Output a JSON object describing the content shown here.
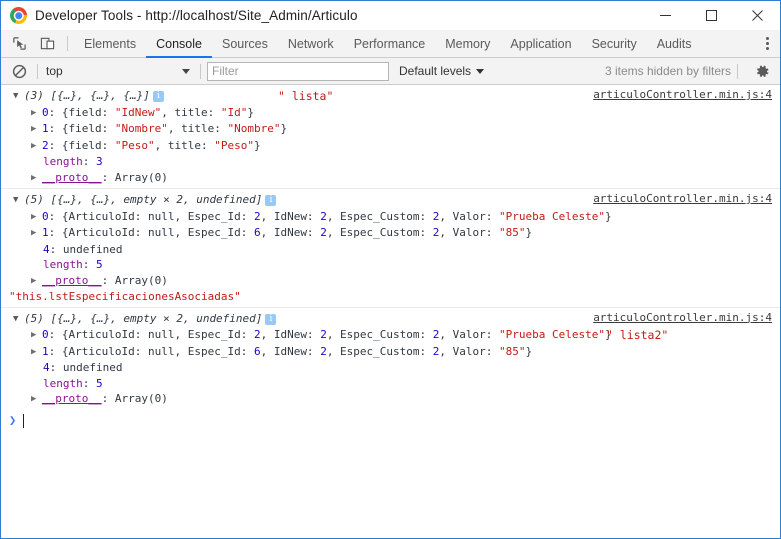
{
  "window": {
    "title": "Developer Tools - http://localhost/Site_Admin/Articulo",
    "logo_icon": "chrome-logo-icon",
    "minimize_icon": "minimize-icon",
    "maximize_icon": "maximize-icon",
    "close_icon": "close-icon"
  },
  "toolbar": {
    "inspect_icon": "inspect-element-icon",
    "device_icon": "device-toolbar-icon",
    "more_icon": "kebab-menu-icon",
    "tabs": [
      {
        "label": "Elements",
        "active": false
      },
      {
        "label": "Console",
        "active": true
      },
      {
        "label": "Sources",
        "active": false
      },
      {
        "label": "Network",
        "active": false
      },
      {
        "label": "Performance",
        "active": false
      },
      {
        "label": "Memory",
        "active": false
      },
      {
        "label": "Application",
        "active": false
      },
      {
        "label": "Security",
        "active": false
      },
      {
        "label": "Audits",
        "active": false
      }
    ],
    "active_tab_accent": "#1a73e8"
  },
  "filterbar": {
    "clear_icon": "clear-console-icon",
    "context_value": "top",
    "context_caret_icon": "chevron-down-icon",
    "filter_placeholder": "Filter",
    "filter_value": "",
    "levels_label": "Default levels",
    "levels_caret_icon": "chevron-down-icon",
    "hidden_items": "3 items hidden by filters",
    "settings_icon": "gear-icon"
  },
  "console": {
    "messages": [
      {
        "source": "articuloController.min.js:4",
        "trailing_label": "\" lista\"",
        "header": {
          "arrow": "▼",
          "count": "(3)",
          "preview": " [{…}, {…}, {…}]",
          "badge": "i"
        },
        "rows": [
          {
            "arrow": "▶",
            "index": "0",
            "body": ": {field: \"IdNew\", title: \"Id\"}"
          },
          {
            "arrow": "▶",
            "index": "1",
            "body": ": {field: \"Nombre\", title: \"Nombre\"}"
          },
          {
            "arrow": "▶",
            "index": "2",
            "body": ": {field: \"Peso\", title: \"Peso\"}"
          },
          {
            "arrow": "",
            "index": "length",
            "body": ": 3"
          },
          {
            "arrow": "▶",
            "index": "__proto__",
            "body": ": Array(0)"
          }
        ]
      },
      {
        "source": "articuloController.min.js:4",
        "trailing_label": "",
        "header": {
          "arrow": "▼",
          "count": "(5)",
          "preview": " [{…}, {…}, empty × 2, undefined]",
          "badge": "i"
        },
        "rows": [
          {
            "arrow": "▶",
            "index": "0",
            "body": ": {ArticuloId: null, Espec_Id: 2, IdNew: 2, Espec_Custom: 2, Valor: \"Prueba Celeste\"}"
          },
          {
            "arrow": "▶",
            "index": "1",
            "body": ": {ArticuloId: null, Espec_Id: 6, IdNew: 2, Espec_Custom: 2, Valor: \"85\"}"
          },
          {
            "arrow": "",
            "index": "4",
            "body": ": undefined"
          },
          {
            "arrow": "",
            "index": "length",
            "body": ": 5"
          },
          {
            "arrow": "▶",
            "index": "__proto__",
            "body": ": Array(0)"
          }
        ],
        "footer_string": "\"this.lstEspecificacionesAsociadas\""
      },
      {
        "source": "articuloController.min.js:4",
        "trailing_label": "\" lista2\"",
        "header": {
          "arrow": "▼",
          "count": "(5)",
          "preview": " [{…}, {…}, empty × 2, undefined]",
          "badge": "i"
        },
        "rows": [
          {
            "arrow": "▶",
            "index": "0",
            "body": ": {ArticuloId: null, Espec_Id: 2, IdNew: 2, Espec_Custom: 2, Valor: \"Prueba Celeste\"}"
          },
          {
            "arrow": "▶",
            "index": "1",
            "body": ": {ArticuloId: null, Espec_Id: 6, IdNew: 2, Espec_Custom: 2, Valor: \"85\"}"
          },
          {
            "arrow": "",
            "index": "4",
            "body": ": undefined"
          },
          {
            "arrow": "",
            "index": "length",
            "body": ": 5"
          },
          {
            "arrow": "▶",
            "index": "__proto__",
            "body": ": Array(0)"
          }
        ]
      }
    ],
    "prompt": {
      "chevron": "❯",
      "value": ""
    },
    "colors": {
      "string": "#c41a16",
      "number": "#1c00cf",
      "property": "#881391",
      "plain": "#303942",
      "link": "#3b3b3b"
    }
  }
}
